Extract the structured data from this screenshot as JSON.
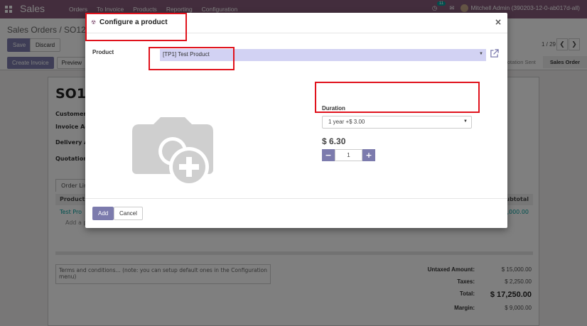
{
  "navbar": {
    "brand": "Sales",
    "menu": [
      "Orders",
      "To Invoice",
      "Products",
      "Reporting",
      "Configuration"
    ],
    "chat_count": "11",
    "user": "Mitchell Admin (390203-12-0-ab017d-all)"
  },
  "control_panel": {
    "breadcrumb": "Sales Orders / SO125",
    "save_label": "Save",
    "discard_label": "Discard",
    "pager": "1 / 29",
    "create_invoice_label": "Create Invoice",
    "preview_label": "Preview",
    "status_steps": [
      "Quotation Sent",
      "Sales Order"
    ]
  },
  "sheet": {
    "order_name": "SO125",
    "labels": [
      "Customer",
      "Invoice Add",
      "Delivery Ad",
      "Quotation T"
    ],
    "order_lines_tab": "Order Line",
    "lines_header": "Product",
    "subtotal_header": "Subtotal",
    "line_product": "Test Pro",
    "line_subtotal": "15,000.00",
    "add_line": "Add a p",
    "terms_placeholder": "Terms and conditions... (note: you can setup default ones in the Configuration menu)",
    "totals": [
      {
        "label": "Untaxed Amount:",
        "value": "$ 15,000.00"
      },
      {
        "label": "Taxes:",
        "value": "$ 2,250.00"
      },
      {
        "label": "Total:",
        "value": "$ 17,250.00"
      },
      {
        "label": "Margin:",
        "value": "$ 9,000.00"
      }
    ]
  },
  "modal": {
    "title": "Configure a product",
    "product_label": "Product",
    "product_value": "[TP1] Test Product",
    "duration_label": "Duration",
    "duration_value": "1 year +$ 3.00",
    "price": "$ 6.30",
    "quantity": "1",
    "add_label": "Add",
    "cancel_label": "Cancel"
  },
  "colors": {
    "brand": "#875a7b",
    "primary_button": "#7c7bad",
    "highlight": "#e0121c",
    "selected_field": "#d2d2f3"
  }
}
